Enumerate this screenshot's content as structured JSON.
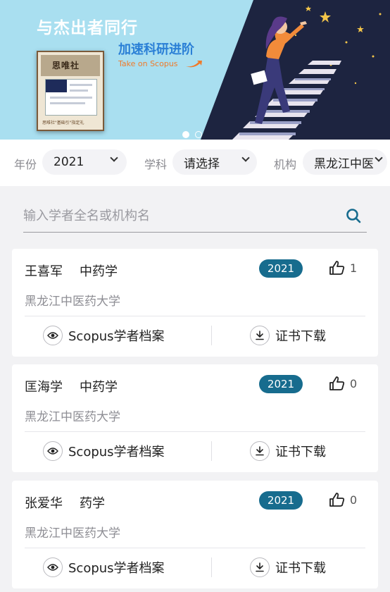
{
  "banner": {
    "title": "与杰出者同行",
    "subtitle": "加速科研进阶",
    "english": "Take on Scopus",
    "book_logo": "思唯社",
    "book_caption": "思唯社\"基础引\"指定礼",
    "active_slide": 1,
    "slide_count": 2,
    "colors": {
      "left_panel": "#a9dff0",
      "night_sky": "#1d2440",
      "accent_orange": "#f07a2a",
      "accent_blue": "#2a7fd6"
    }
  },
  "filters": {
    "year_label": "年份",
    "year_value": "2021",
    "subject_label": "学科",
    "subject_value": "请选择",
    "institution_label": "机构",
    "institution_value": "黑龙江中医"
  },
  "search": {
    "placeholder": "输入学者全名或机构名",
    "icon": "search-icon"
  },
  "cards": [
    {
      "name": "王喜军",
      "subject": "中药学",
      "year": "2021",
      "likes": "1",
      "institution": "黑龙江中医药大学",
      "profile_label": "Scopus学者档案",
      "download_label": "证书下载"
    },
    {
      "name": "匡海学",
      "subject": "中药学",
      "year": "2021",
      "likes": "0",
      "institution": "黑龙江中医药大学",
      "profile_label": "Scopus学者档案",
      "download_label": "证书下载"
    },
    {
      "name": "张爱华",
      "subject": "药学",
      "year": "2021",
      "likes": "0",
      "institution": "黑龙江中医药大学",
      "profile_label": "Scopus学者档案",
      "download_label": "证书下载"
    }
  ],
  "colors": {
    "badge": "#176c8e",
    "search_icon": "#176c8e",
    "page_bg": "#f2f2f4"
  }
}
